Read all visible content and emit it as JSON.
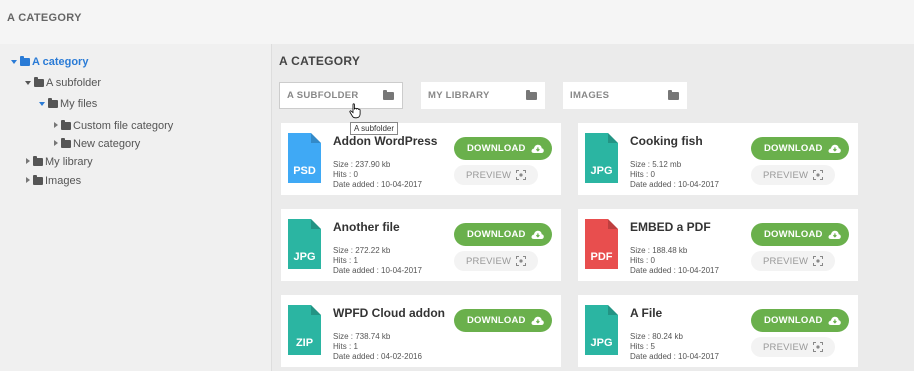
{
  "header": {
    "title": "A CATEGORY"
  },
  "tree": {
    "items": [
      {
        "label": "A category"
      },
      {
        "label": "A subfolder"
      },
      {
        "label": "My files"
      },
      {
        "label": "Custom file category"
      },
      {
        "label": "New category"
      },
      {
        "label": "My library"
      },
      {
        "label": "Images"
      }
    ]
  },
  "main": {
    "title": "A CATEGORY",
    "folders": [
      {
        "label": "A SUBFOLDER"
      },
      {
        "label": "MY LIBRARY"
      },
      {
        "label": "IMAGES"
      }
    ],
    "tooltip": "A subfolder",
    "download_label": "DOWNLOAD",
    "preview_label": "PREVIEW",
    "files": [
      {
        "name": "Addon WordPress",
        "ext": "PSD",
        "size": "Size : 237.90 kb",
        "hits": "Hits : 0",
        "date": "Date added : 10-04-2017",
        "color": "#3fa9f5"
      },
      {
        "name": "Cooking fish",
        "ext": "JPG",
        "size": "Size : 5.12 mb",
        "hits": "Hits : 0",
        "date": "Date added : 10-04-2017",
        "color": "#2bb5a2"
      },
      {
        "name": "Another file",
        "ext": "JPG",
        "size": "Size : 272.22 kb",
        "hits": "Hits : 1",
        "date": "Date added : 10-04-2017",
        "color": "#2bb5a2"
      },
      {
        "name": "EMBED a PDF",
        "ext": "PDF",
        "size": "Size : 188.48 kb",
        "hits": "Hits : 0",
        "date": "Date added : 10-04-2017",
        "color": "#e84e4e"
      },
      {
        "name": "WPFD Cloud addon",
        "ext": "ZIP",
        "size": "Size : 738.74 kb",
        "hits": "Hits : 1",
        "date": "Date added : 04-02-2016",
        "color": "#2bb5a2"
      },
      {
        "name": "A File",
        "ext": "JPG",
        "size": "Size : 80.24 kb",
        "hits": "Hits : 5",
        "date": "Date added : 10-04-2017",
        "color": "#2bb5a2"
      }
    ]
  }
}
